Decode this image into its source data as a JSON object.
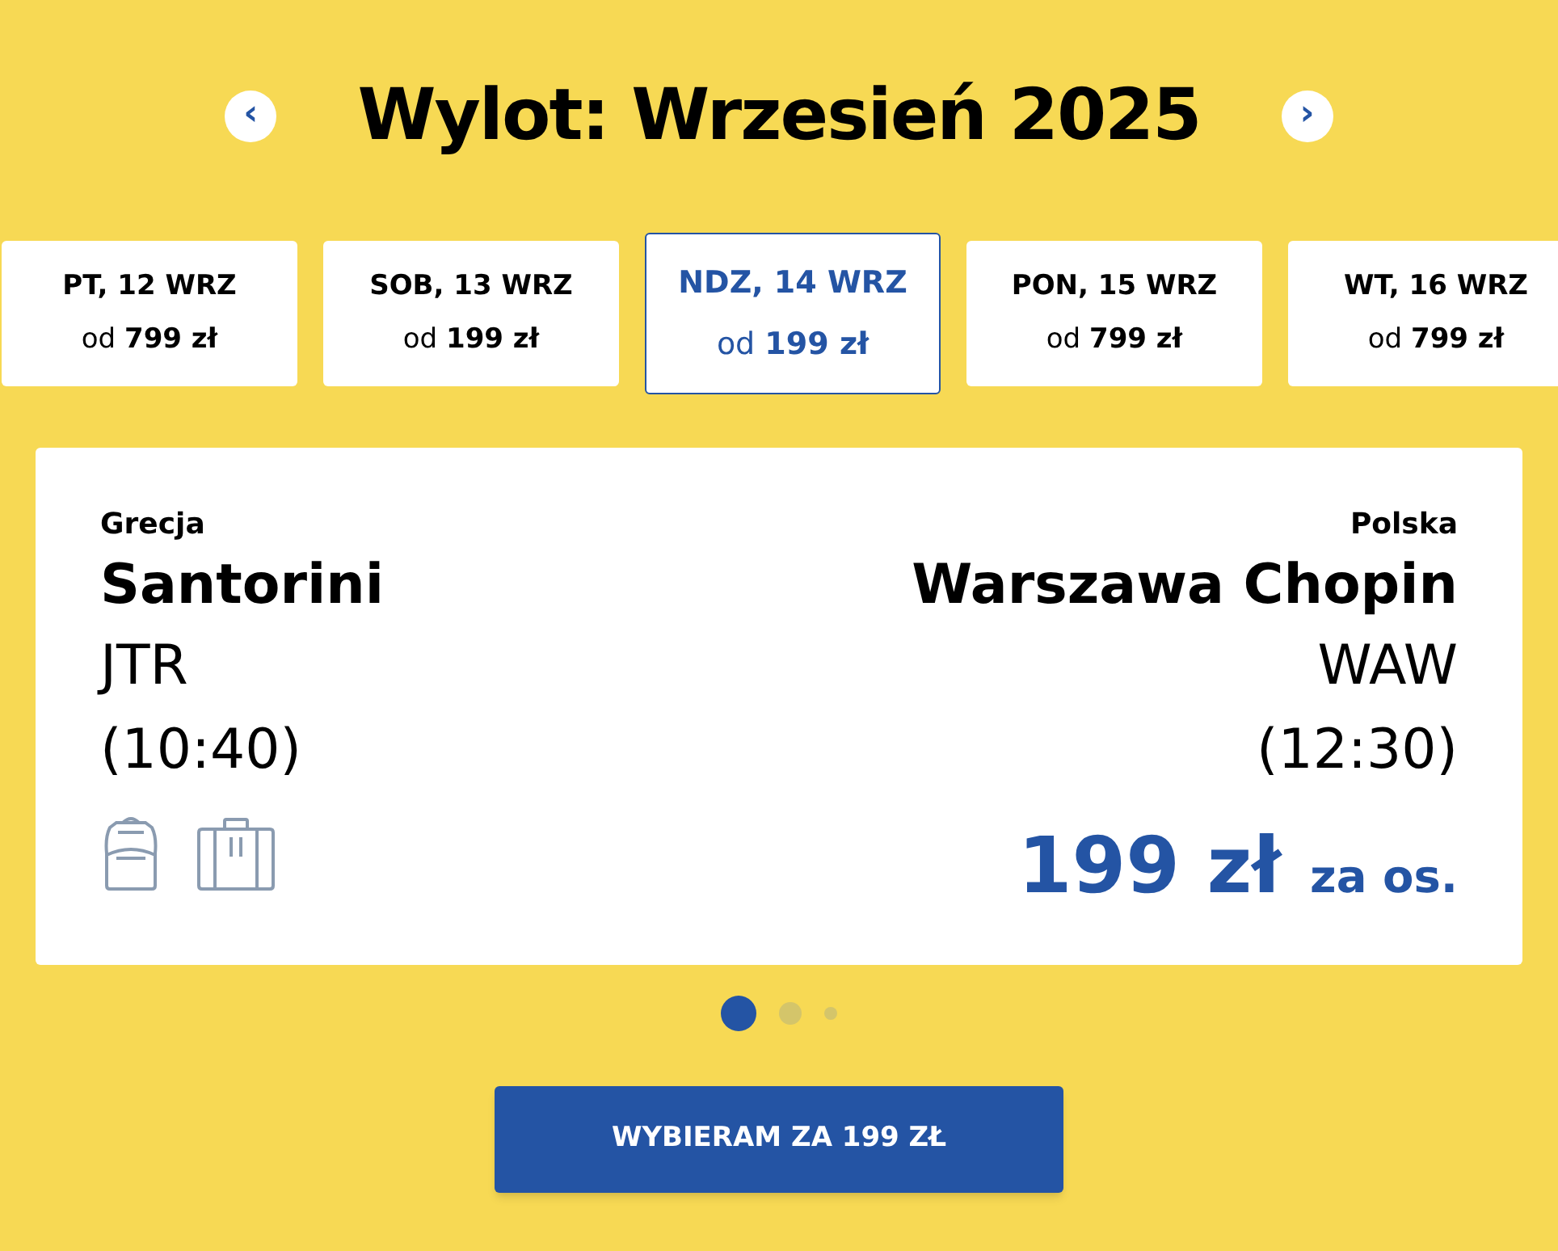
{
  "header": {
    "title": "Wylot: Wrzesień 2025",
    "prev_label": "‹",
    "next_label": "›"
  },
  "dates": [
    {
      "day": "PT, 12 WRZ",
      "price": "od **799 zł**",
      "selected": false
    },
    {
      "day": "SOB, 13 WRZ",
      "price": "od **199 zł**",
      "selected": false
    },
    {
      "day": "NDZ, 14 WRZ",
      "price": "od **199 zł**",
      "selected": true
    },
    {
      "day": "PON, 15 WRZ",
      "price": "od **799 zł**",
      "selected": false
    },
    {
      "day": "WT, 16 WRZ",
      "price": "od **799 zł**",
      "selected": false
    }
  ],
  "flight": {
    "origin": {
      "country": "Grecja",
      "city": "Santorini",
      "code": "JTR",
      "time": "(10:40)"
    },
    "destination": {
      "country": "Polska",
      "city": "Warszawa Chopin",
      "code": "WAW",
      "time": "(12:30)"
    },
    "price": "199 zł",
    "price_suffix": "za os."
  },
  "pager": [
    {
      "selected": true
    },
    {
      "selected": false
    },
    {
      "selected": false
    }
  ],
  "cta": {
    "label": "WYBIERAM ZA 199 ZŁ"
  }
}
